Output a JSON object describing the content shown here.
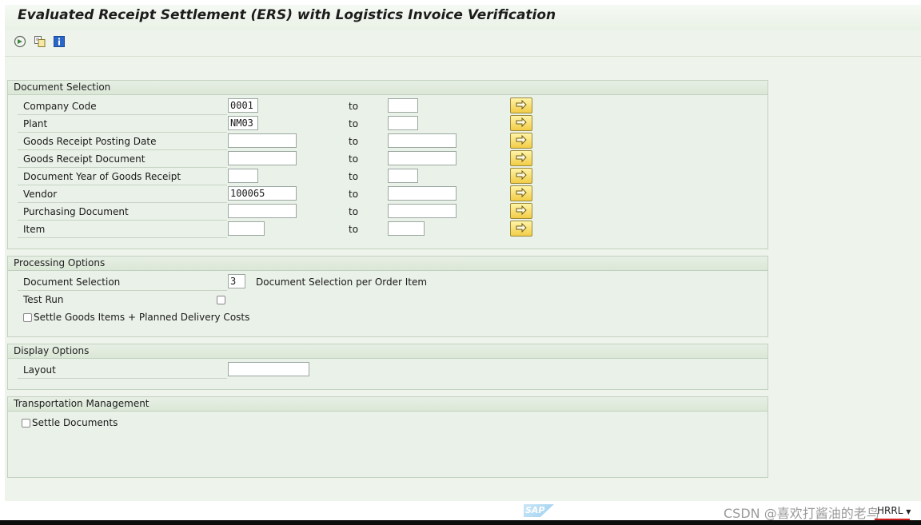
{
  "window": {
    "title": "Evaluated Receipt Settlement (ERS) with Logistics Invoice Verification"
  },
  "toolbar": {
    "icons": [
      "execute-icon",
      "get-variant-icon",
      "info-icon"
    ]
  },
  "document_selection": {
    "header": "Document Selection",
    "to_label": "to",
    "rows": [
      {
        "label": "Company Code",
        "from": "0001",
        "to": ""
      },
      {
        "label": "Plant",
        "from": "NM03",
        "to": ""
      },
      {
        "label": "Goods Receipt Posting Date",
        "from": "",
        "to": ""
      },
      {
        "label": "Goods Receipt Document",
        "from": "",
        "to": ""
      },
      {
        "label": "Document Year of Goods Receipt",
        "from": "",
        "to": ""
      },
      {
        "label": "Vendor",
        "from": "100065",
        "to": ""
      },
      {
        "label": "Purchasing Document",
        "from": "",
        "to": ""
      },
      {
        "label": "Item",
        "from": "",
        "to": ""
      }
    ]
  },
  "processing_options": {
    "header": "Processing Options",
    "doc_selection_label": "Document Selection",
    "doc_selection_value": "3",
    "doc_selection_desc": "Document Selection per Order Item",
    "test_run_label": "Test Run",
    "settle_label": "Settle Goods Items + Planned Delivery Costs"
  },
  "display_options": {
    "header": "Display Options",
    "layout_label": "Layout",
    "layout_value": ""
  },
  "transportation": {
    "header": "Transportation Management",
    "settle_docs_label": "Settle Documents"
  },
  "footer": {
    "sap_logo": "SAP",
    "watermark": "CSDN @喜欢打酱油的老鸟",
    "system": "HRRL"
  }
}
